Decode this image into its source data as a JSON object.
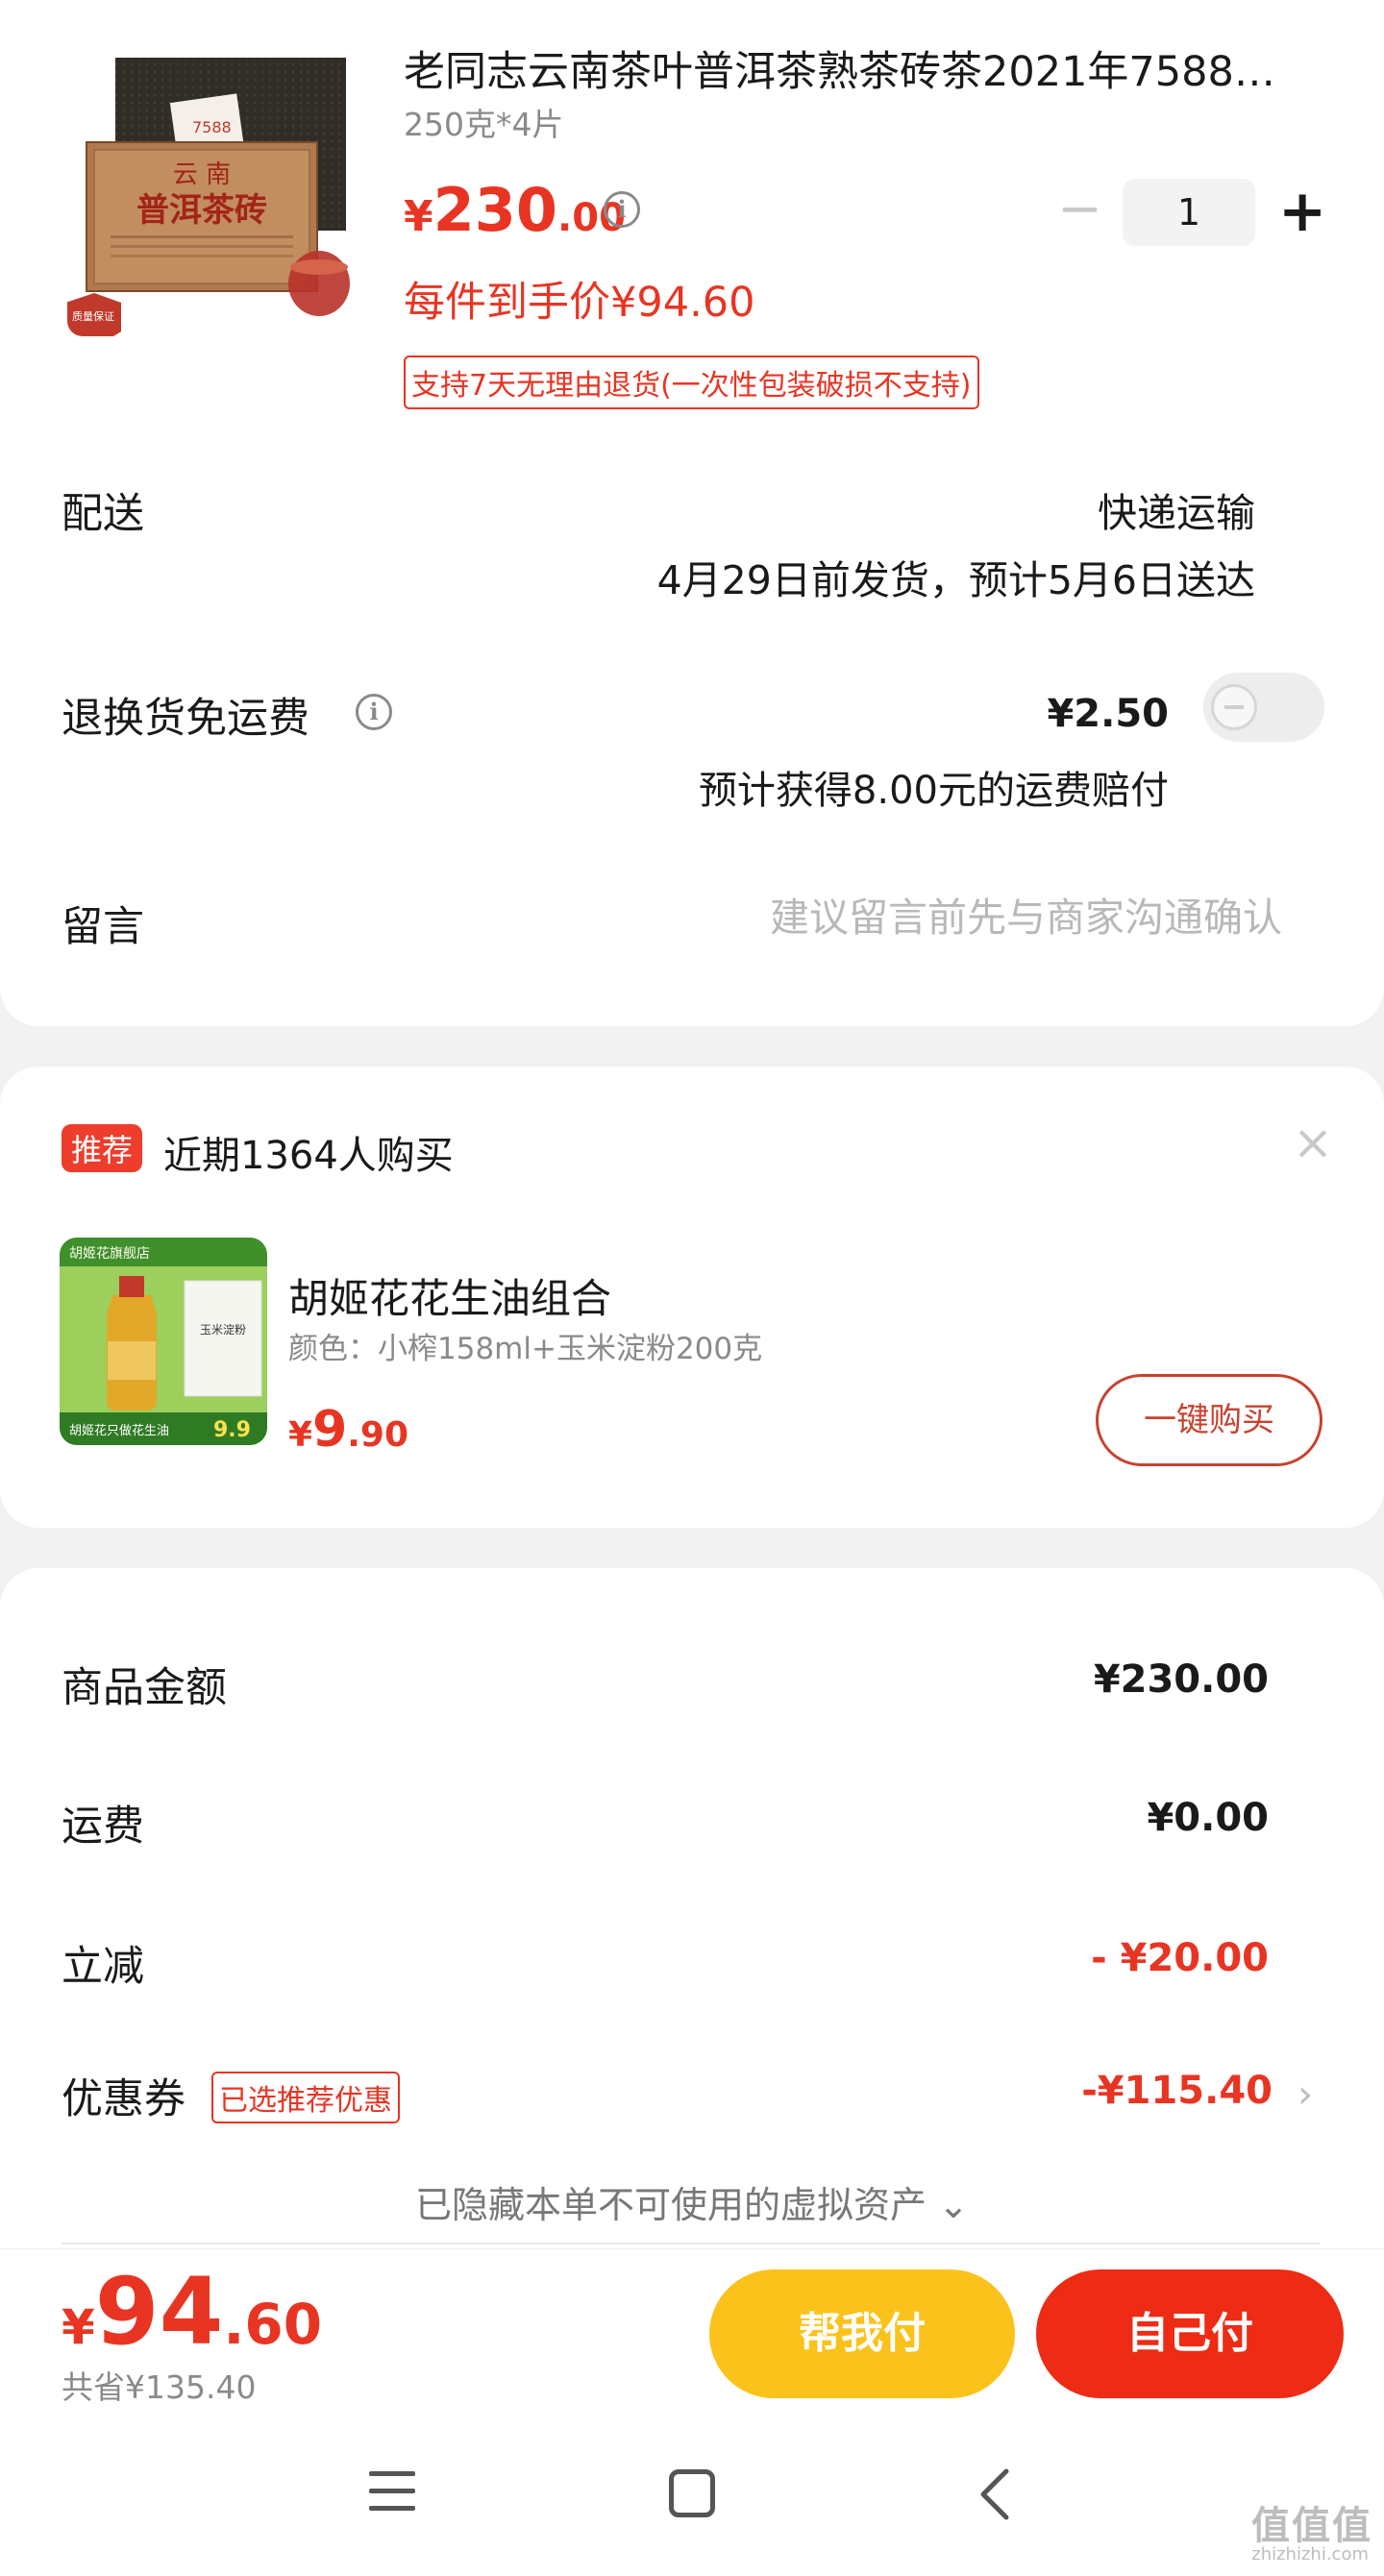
{
  "product": {
    "title": "老同志云南茶叶普洱茶熟茶砖茶2021年7588…",
    "spec": "250克*4片",
    "price_symbol": "¥",
    "price_int": "230",
    "price_dec": ".00",
    "per_price": "每件到手价¥94.60",
    "return_tag": "支持7天无理由退货(一次性包装破损不支持)",
    "quantity": "1",
    "image": {
      "text_top": "云 南",
      "text_main": "普洱茶砖",
      "badge": "质量保证",
      "code": "7588"
    }
  },
  "delivery": {
    "label": "配送",
    "method": "快递运输",
    "date": "4月29日前发货，预计5月6日送达"
  },
  "return_fee": {
    "label": "退换货免运费",
    "price": "¥2.50",
    "note": "预计获得8.00元的运费赔付",
    "enabled": false
  },
  "message": {
    "label": "留言",
    "placeholder": "建议留言前先与商家沟通确认"
  },
  "recommend": {
    "badge": "推荐",
    "title": "近期1364人购买",
    "close": "×",
    "item_name": "胡姬花花生油组合",
    "item_spec": "颜色：小榨158ml+玉米淀粉200克",
    "price_symbol": "¥",
    "price_int": "9",
    "price_dec": ".90",
    "buy_label": "一键购买",
    "image": {
      "shop": "胡姬花旗舰店",
      "caption": "胡姬花只做花生油",
      "corn": "玉米淀粉",
      "price": "9.9"
    }
  },
  "summary": {
    "goods_label": "商品金额",
    "goods_value": "¥230.00",
    "shipping_label": "运费",
    "shipping_value": "¥0.00",
    "discount_label": "立减",
    "discount_value": "- ¥20.00",
    "coupon_label": "优惠券",
    "coupon_tag": "已选推荐优惠",
    "coupon_value": "-¥115.40",
    "hidden_assets": "已隐藏本单不可使用的虚拟资产 ⌄"
  },
  "footer": {
    "price_symbol": "¥",
    "price_int": "94",
    "price_dec": ".60",
    "saved": "共省¥135.40",
    "help_pay": "帮我付",
    "self_pay": "自己付"
  },
  "watermark": {
    "main": "值值值",
    "sub": "zhizhizhi.com"
  },
  "colors": {
    "accent": "#e83523",
    "help_button": "#fbc21b",
    "pay_button": "#ee2b14"
  }
}
